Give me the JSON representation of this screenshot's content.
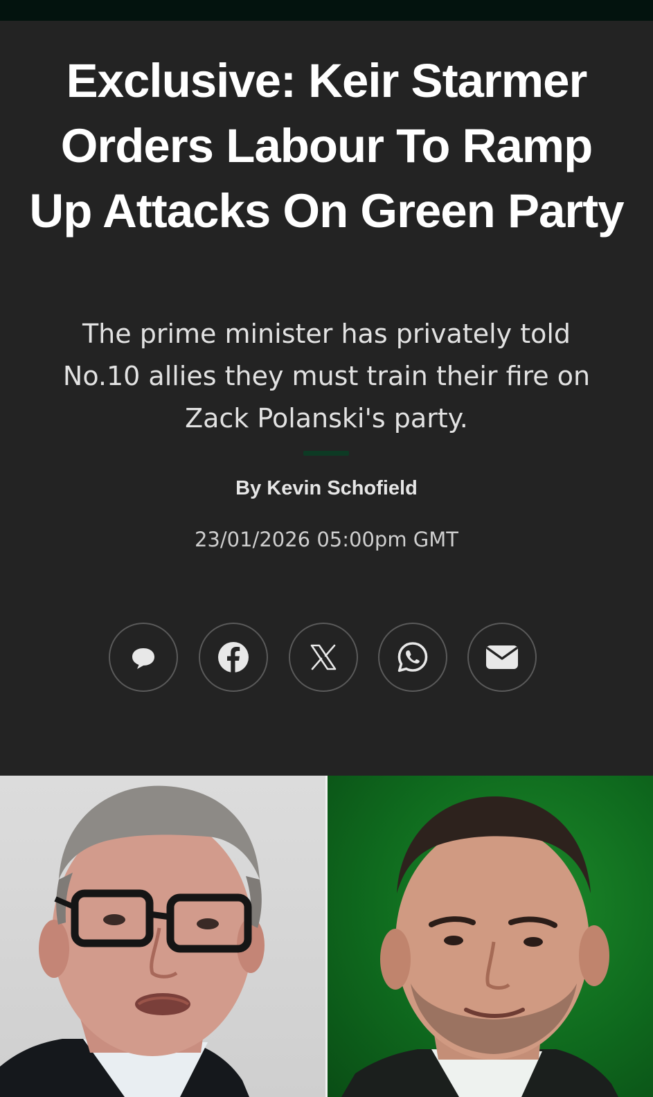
{
  "article": {
    "headline": "Exclusive: Keir Starmer Orders Labour To Ramp Up Attacks On Green Party",
    "standfirst": "The prime minister has privately told No.10 allies they must train their fire on Zack Polanski's party.",
    "byline": "By Kevin Schofield",
    "timestamp": "23/01/2026 05:00pm GMT"
  },
  "share": {
    "buttons": [
      {
        "icon": "comment-icon"
      },
      {
        "icon": "facebook-icon"
      },
      {
        "icon": "x-icon"
      },
      {
        "icon": "whatsapp-icon"
      },
      {
        "icon": "email-icon"
      }
    ]
  },
  "colors": {
    "background": "#232323",
    "top_strip": "#03130e",
    "accent": "#0d3a24",
    "text": "#ffffff",
    "photo_right_bg": "#137a22"
  }
}
